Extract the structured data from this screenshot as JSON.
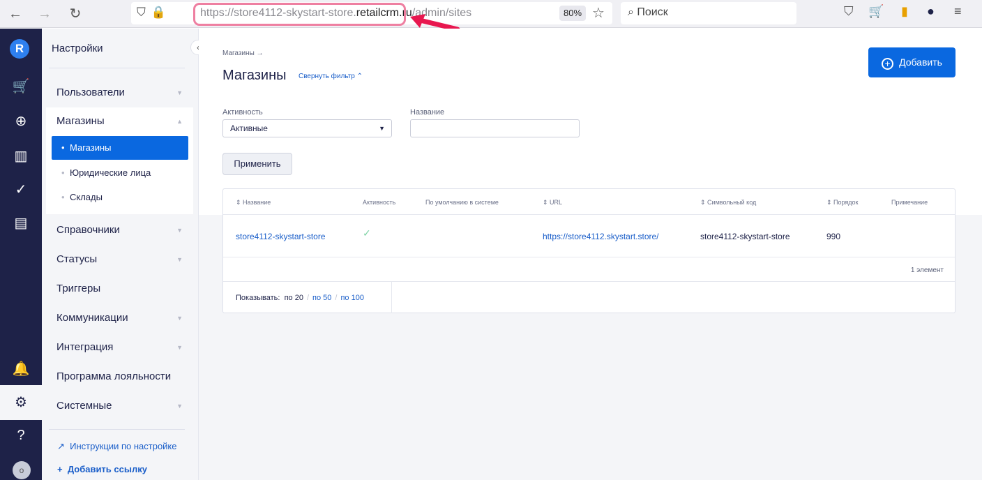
{
  "browser": {
    "url_prefix": "https://store4112-skystart-store.",
    "url_domain": "retailcrm.ru",
    "url_path": "/admin/sites",
    "zoom": "80%",
    "search_placeholder": "Поиск"
  },
  "sidebar": {
    "title": "Настройки",
    "items": [
      {
        "label": "Пользователи"
      },
      {
        "label": "Магазины"
      },
      {
        "label": "Справочники"
      },
      {
        "label": "Статусы"
      },
      {
        "label": "Триггеры"
      },
      {
        "label": "Коммуникации"
      },
      {
        "label": "Интеграция"
      },
      {
        "label": "Программа лояльности"
      },
      {
        "label": "Системные"
      }
    ],
    "subitems": [
      {
        "label": "Магазины"
      },
      {
        "label": "Юридические лица"
      },
      {
        "label": "Склады"
      }
    ],
    "links": {
      "instructions": "Инструкции по настройке",
      "add_link": "Добавить ссылку"
    },
    "avatar_letter": "o"
  },
  "main": {
    "breadcrumb": "Магазины →",
    "title": "Магазины",
    "collapse_filter": "Свернуть фильтр ⌃",
    "add_button": "Добавить",
    "filters": {
      "activity_label": "Активность",
      "activity_value": "Активные",
      "name_label": "Название",
      "name_value": ""
    },
    "apply_button": "Применить",
    "table": {
      "columns": [
        "Название",
        "Активность",
        "По умолчанию в системе",
        "URL",
        "Символьный код",
        "Порядок",
        "Примечание"
      ],
      "rows": [
        {
          "name": "store4112-skystart-store",
          "active": true,
          "url": "https://store4112.skystart.store/",
          "code": "store4112-skystart-store",
          "order": "990",
          "note": ""
        }
      ],
      "count": "1 элемент",
      "pager": {
        "label": "Показывать:",
        "current": "по 20",
        "opt50": "по 50",
        "opt100": "по 100"
      }
    }
  },
  "colors": {
    "accent": "#0a68e0",
    "rail": "#1e2248",
    "highlight": "#ee7fa1",
    "arrow": "#e8174f"
  }
}
